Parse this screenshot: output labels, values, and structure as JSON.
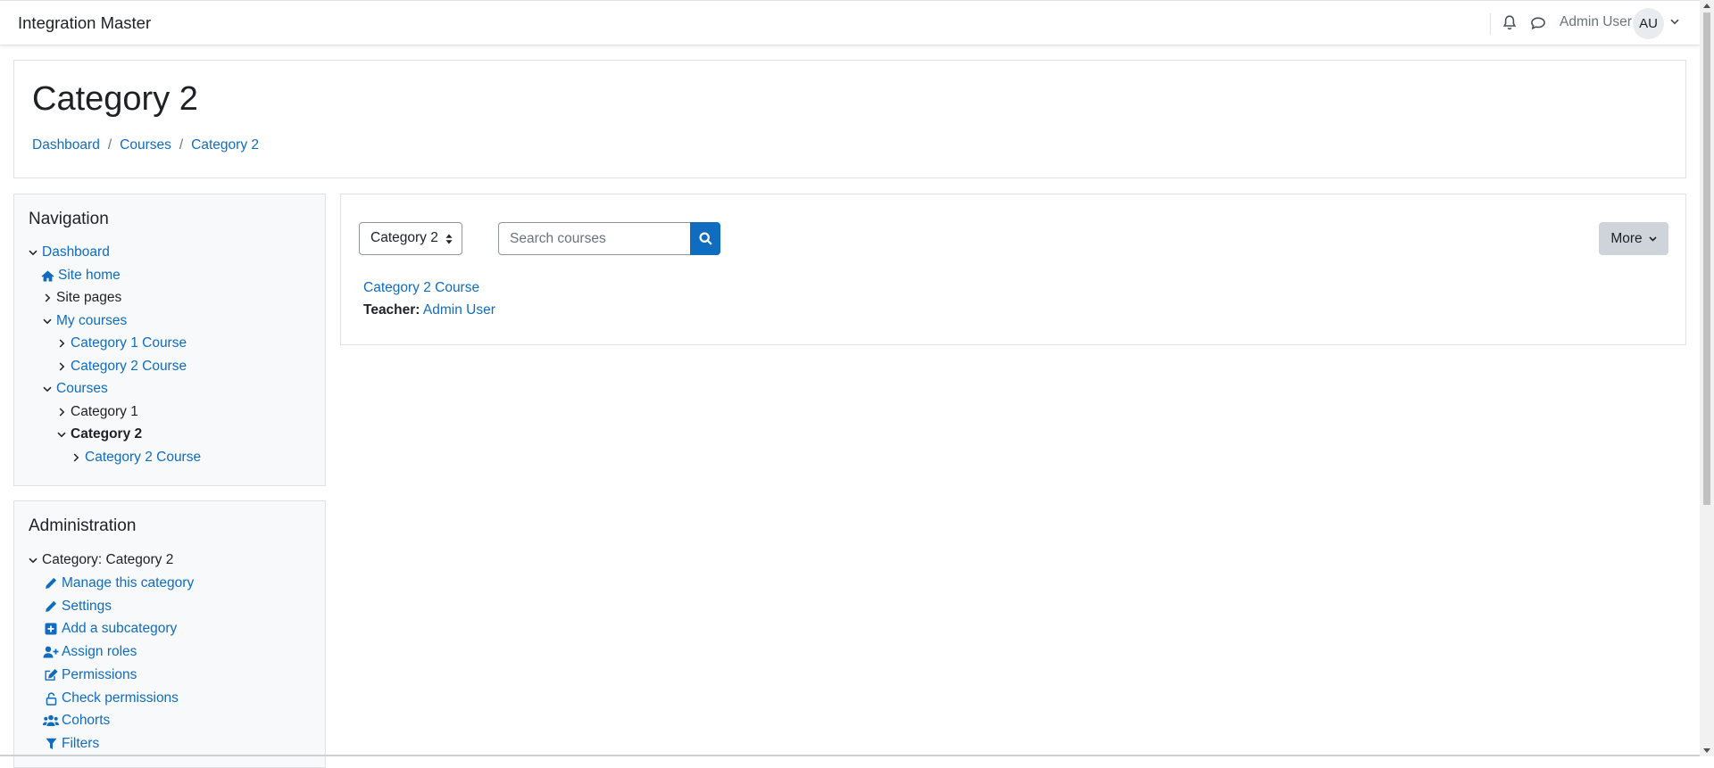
{
  "navbar": {
    "brand": "Integration Master",
    "user_name": "Admin User",
    "avatar_initials": "AU",
    "icons": [
      "bell-icon",
      "chat-icon",
      "chevron-down-icon"
    ]
  },
  "header": {
    "title": "Category 2",
    "breadcrumb": [
      "Dashboard",
      "Courses",
      "Category 2"
    ],
    "breadcrumb_sep": "/"
  },
  "navigation": {
    "title": "Navigation",
    "items": [
      {
        "label": "Dashboard",
        "chevron": "down",
        "link": true
      },
      {
        "label": "Site home",
        "icon": "home-icon",
        "link": true
      },
      {
        "label": "Site pages",
        "chevron": "right",
        "link": false
      },
      {
        "label": "My courses",
        "chevron": "down",
        "link": true
      },
      {
        "label": "Category 1 Course",
        "chevron": "right",
        "link": true
      },
      {
        "label": "Category 2 Course",
        "chevron": "right",
        "link": true
      },
      {
        "label": "Courses",
        "chevron": "down",
        "link": true
      },
      {
        "label": "Category 1",
        "chevron": "right",
        "link": false
      },
      {
        "label": "Category 2",
        "chevron": "down",
        "link": false,
        "active": true
      },
      {
        "label": "Category 2 Course",
        "chevron": "right",
        "link": true
      }
    ]
  },
  "administration": {
    "title": "Administration",
    "items": [
      {
        "label": "Category: Category 2",
        "chevron": "down",
        "link": false
      },
      {
        "label": "Manage this category",
        "icon": "pencil-icon",
        "link": true
      },
      {
        "label": "Settings",
        "icon": "pencil-icon",
        "link": true
      },
      {
        "label": "Add a subcategory",
        "icon": "plus-square-icon",
        "link": true
      },
      {
        "label": "Assign roles",
        "icon": "user-plus-icon",
        "link": true
      },
      {
        "label": "Permissions",
        "icon": "edit-square-icon",
        "link": true
      },
      {
        "label": "Check permissions",
        "icon": "unlock-icon",
        "link": true
      },
      {
        "label": "Cohorts",
        "icon": "users-icon",
        "link": true
      },
      {
        "label": "Filters",
        "icon": "filter-icon",
        "link": true
      }
    ]
  },
  "main": {
    "category_select": "Category 2",
    "search_placeholder": "Search courses",
    "more_label": "More",
    "course": {
      "name": "Category 2 Course",
      "teacher_label": "Teacher:",
      "teacher_name": "Admin User"
    }
  },
  "colors": {
    "link": "#0f6cbf",
    "text": "#1d2125",
    "border": "#dee2e6",
    "block_bg": "#f8f9fa",
    "more_button_bg": "#ced4da"
  }
}
